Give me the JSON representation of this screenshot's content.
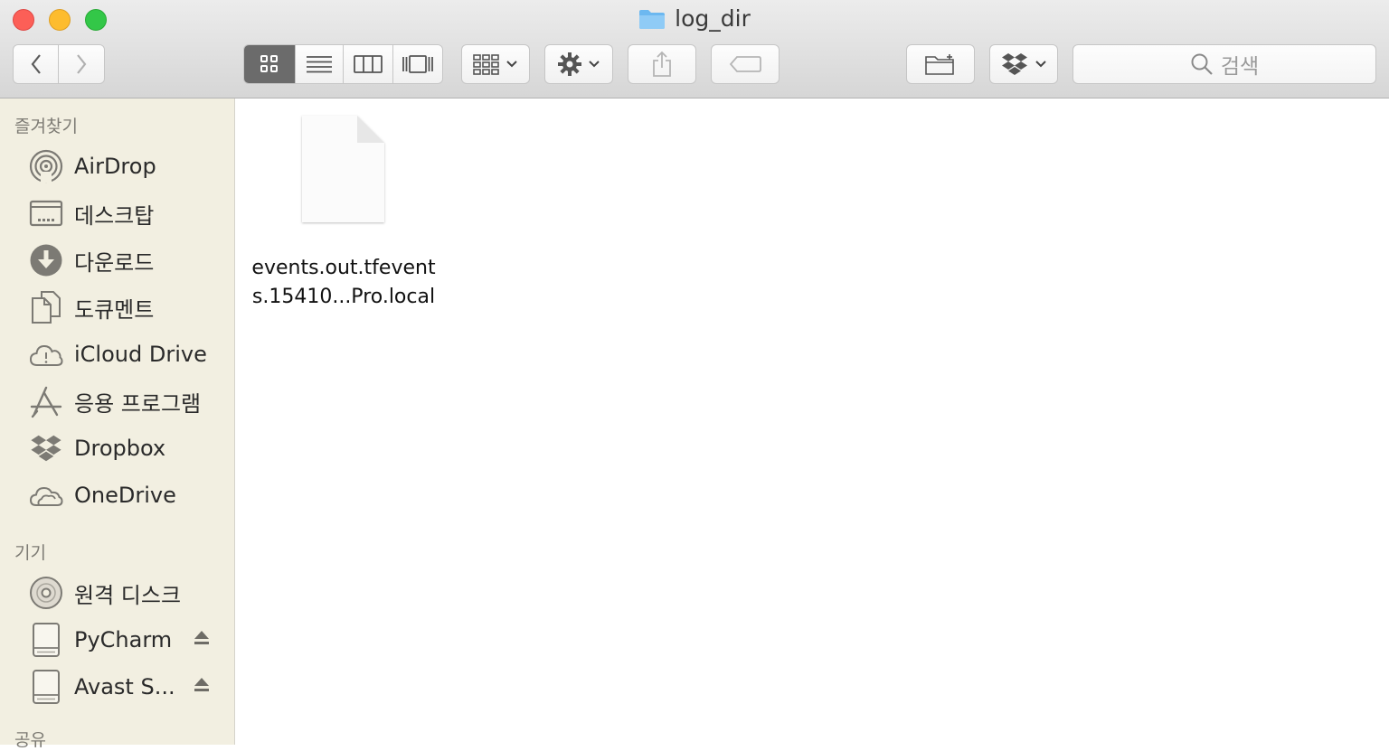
{
  "window": {
    "title": "log_dir"
  },
  "search": {
    "placeholder": "검색"
  },
  "sidebar": {
    "favorites_title": "즐겨찾기",
    "favorites": [
      {
        "label": "AirDrop",
        "icon": "airdrop-icon"
      },
      {
        "label": "데스크탑",
        "icon": "desktop-icon"
      },
      {
        "label": "다운로드",
        "icon": "downloads-icon"
      },
      {
        "label": "도큐멘트",
        "icon": "documents-icon"
      },
      {
        "label": "iCloud Drive",
        "icon": "icloud-icon"
      },
      {
        "label": "응용 프로그램",
        "icon": "applications-icon"
      },
      {
        "label": "Dropbox",
        "icon": "dropbox-icon"
      },
      {
        "label": "OneDrive",
        "icon": "onedrive-icon"
      }
    ],
    "devices_title": "기기",
    "devices": [
      {
        "label": "원격 디스크",
        "icon": "remote-disc-icon"
      },
      {
        "label": "PyCharm",
        "icon": "drive-icon"
      },
      {
        "label": "Avast S...",
        "icon": "drive-icon"
      }
    ],
    "shared_title": "공유"
  },
  "content": {
    "files": [
      {
        "name_line1": "events.out.tfevent",
        "name_line2": "s.15410...Pro.local"
      }
    ]
  }
}
